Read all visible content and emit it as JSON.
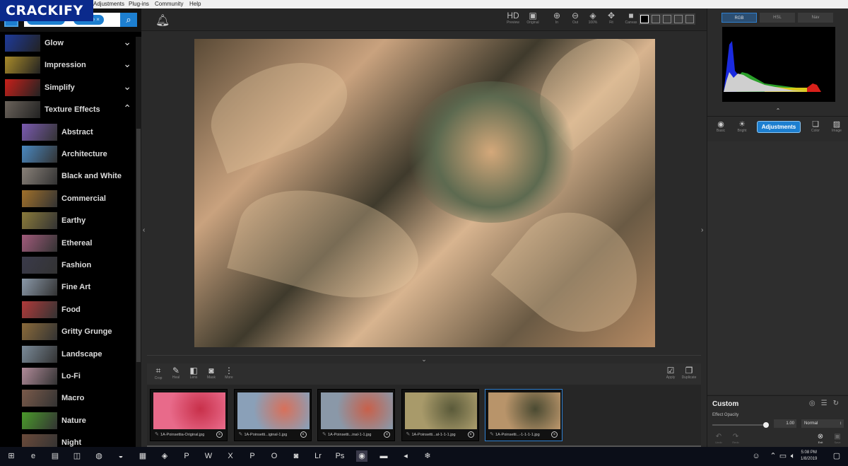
{
  "watermark": "CRACKIFY",
  "menu": [
    "Adjustments",
    "Plug-ins",
    "Community",
    "Help"
  ],
  "search": {
    "chips": [
      "Texture ...",
      "Nature"
    ],
    "chip_close": "×",
    "button_icon": "search-icon"
  },
  "categories": [
    {
      "label": "Glow",
      "expanded": false,
      "thumb": "#1e3a9a"
    },
    {
      "label": "Impression",
      "expanded": false,
      "thumb": "#a88a2a"
    },
    {
      "label": "Simplify",
      "expanded": false,
      "thumb": "#c8201a"
    },
    {
      "label": "Texture Effects",
      "expanded": true,
      "thumb": "#6a625a"
    }
  ],
  "subcategories": [
    {
      "label": "Abstract",
      "thumb": "#7a5ab0"
    },
    {
      "label": "Architecture",
      "thumb": "#4a88c0"
    },
    {
      "label": "Black and White",
      "thumb": "#888078"
    },
    {
      "label": "Commercial",
      "thumb": "#a0702a"
    },
    {
      "label": "Earthy",
      "thumb": "#8a7a3a"
    },
    {
      "label": "Ethereal",
      "thumb": "#a05a7a"
    },
    {
      "label": "Fashion",
      "thumb": "#3a3a4a"
    },
    {
      "label": "Fine Art",
      "thumb": "#8a98a8"
    },
    {
      "label": "Food",
      "thumb": "#b03a3a"
    },
    {
      "label": "Gritty Grunge",
      "thumb": "#8a6a3a"
    },
    {
      "label": "Landscape",
      "thumb": "#7a8a98"
    },
    {
      "label": "Lo-Fi",
      "thumb": "#b08a98"
    },
    {
      "label": "Macro",
      "thumb": "#7a5a4a"
    },
    {
      "label": "Nature",
      "thumb": "#4a9a2a"
    },
    {
      "label": "Night",
      "thumb": "#6a4a3a"
    }
  ],
  "toolbar": {
    "notification_icon": "bell-icon",
    "buttons": [
      {
        "label": "Preview",
        "icon": "HD"
      },
      {
        "label": "Original",
        "icon": "▣"
      },
      {
        "label": "In",
        "icon": "⊕"
      },
      {
        "label": "Out",
        "icon": "⊖"
      },
      {
        "label": "100%",
        "icon": "◈"
      },
      {
        "label": "Fit",
        "icon": "✥"
      },
      {
        "label": "Canvas",
        "icon": "■"
      }
    ]
  },
  "edit_tools": [
    {
      "label": "Crop",
      "icon": "⌗"
    },
    {
      "label": "Heal",
      "icon": "✎"
    },
    {
      "label": "Lens",
      "icon": "◧"
    },
    {
      "label": "Mask",
      "icon": "◙"
    },
    {
      "label": "More",
      "icon": "⋮"
    }
  ],
  "actions": [
    {
      "label": "Apply",
      "icon": "☑"
    },
    {
      "label": "Duplicate",
      "icon": "❐"
    }
  ],
  "filmstrip": [
    {
      "name": "1A-Poinsettia-Original.jpg",
      "colors": [
        "#e86a8a",
        "#c8304a"
      ],
      "selected": false
    },
    {
      "name": "1A-Poinsetti...iginal-1.jpg",
      "colors": [
        "#8aa0b8",
        "#d8705a"
      ],
      "selected": false
    },
    {
      "name": "1A-Poinsetti...inal-1-1.jpg",
      "colors": [
        "#8a98a8",
        "#c8604a"
      ],
      "selected": false
    },
    {
      "name": "1A-Poinsetti...al-1-1-1.jpg",
      "colors": [
        "#a89a6a",
        "#5a5a3a"
      ],
      "selected": false
    },
    {
      "name": "1A-Poinsetti...-1-1-1-1.jpg",
      "colors": [
        "#b8946a",
        "#4a4a32"
      ],
      "selected": true
    }
  ],
  "histogram": {
    "tabs": [
      {
        "label": "RGB",
        "active": true
      },
      {
        "label": "HSL",
        "active": false
      },
      {
        "label": "Nav",
        "active": false
      }
    ]
  },
  "panel_tools": [
    {
      "label": "Basic",
      "icon": "◉"
    },
    {
      "label": "Bright",
      "icon": "☀"
    },
    {
      "label": "Color",
      "icon": "❏"
    },
    {
      "label": "Image",
      "icon": "▨"
    }
  ],
  "active_panel": "Adjustments",
  "custom": {
    "title": "Custom",
    "opacity_label": "Effect Opacity",
    "opacity_value": "1.00",
    "opacity_fraction": 1.0,
    "blend_mode": "Normal",
    "undo_label": "Undo",
    "redo_label": "Redo",
    "exit_label": "Exit",
    "save_label": "Save"
  },
  "taskbar": {
    "icons": [
      "⊞",
      "e",
      "▤",
      "◫",
      "◍",
      "◒",
      "▦",
      "◈",
      "P",
      "W",
      "X",
      "P",
      "O",
      "◙",
      "Lr",
      "Ps",
      "◉",
      "▬",
      "◂",
      "❄"
    ],
    "time": "5:08 PM",
    "date": "1/8/2019"
  }
}
